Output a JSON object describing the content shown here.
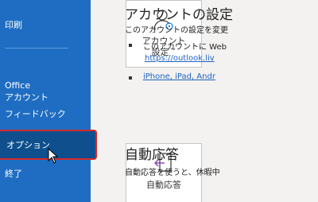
{
  "sidebar": {
    "items": [
      {
        "label": "印刷"
      },
      {
        "label": "Office\nアカウント"
      },
      {
        "label": "フィードバック"
      },
      {
        "label": "オプション"
      },
      {
        "label": "終了"
      }
    ]
  },
  "main": {
    "account": {
      "tile_label": "アカウント\n設定 ˅",
      "title": "アカウントの設定",
      "desc": "このアカウントの設定を変更",
      "bullet1": "このアカウントに Web",
      "link1": "https://outlook.liv",
      "link2": "iPhone, iPad, Andr"
    },
    "auto_reply": {
      "tile_label": "自動応答",
      "title": "自動応答",
      "desc": "自動応答を使うと、休暇中"
    }
  },
  "colors": {
    "sidebar_bg": "#1e6dc2",
    "selected_bg": "#0f4f8e",
    "highlight_border": "#d42a2a",
    "link": "#1e62c1"
  }
}
